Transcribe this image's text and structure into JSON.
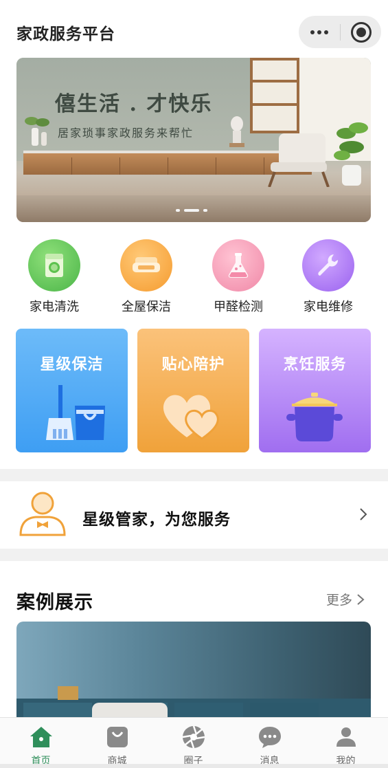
{
  "app": {
    "title": "家政服务平台"
  },
  "capsule": {
    "more_icon": "more-dots-icon",
    "close_icon": "target-close-icon"
  },
  "banner": {
    "title": "僖生活 . 才快乐",
    "subtitle": "居家琐事家政服务来帮忙",
    "slides": 3,
    "active_slide": 2
  },
  "categories": [
    {
      "label": "家电清洗",
      "icon": "washing-machine-icon",
      "color": "#5fc75a"
    },
    {
      "label": "全屋保洁",
      "icon": "sofa-icon",
      "color": "#f5a23a"
    },
    {
      "label": "甲醛检测",
      "icon": "flask-icon",
      "color": "#f08aa8"
    },
    {
      "label": "家电维修",
      "icon": "wrench-icon",
      "color": "#a56cf0"
    }
  ],
  "service_cards": [
    {
      "title": "星级保洁",
      "icon": "broom-bucket-icon",
      "color": "#3ea0f5"
    },
    {
      "title": "贴心陪护",
      "icon": "hearts-icon",
      "color": "#f3a33e"
    },
    {
      "title": "烹饪服务",
      "icon": "cooking-pot-icon",
      "color": "#a77af2"
    }
  ],
  "butler": {
    "text": "星级管家，为您服务",
    "icon": "butler-icon"
  },
  "cases": {
    "title": "案例展示",
    "more": "更多"
  },
  "tabbar": [
    {
      "label": "首页",
      "icon": "home-icon",
      "active": true
    },
    {
      "label": "商城",
      "icon": "shopping-bag-icon",
      "active": false
    },
    {
      "label": "圈子",
      "icon": "aperture-icon",
      "active": false
    },
    {
      "label": "消息",
      "icon": "chat-bubble-icon",
      "active": false
    },
    {
      "label": "我的",
      "icon": "user-icon",
      "active": false
    }
  ],
  "colors": {
    "accent": "#2f8f5b",
    "divider": "#f1f1f1"
  }
}
